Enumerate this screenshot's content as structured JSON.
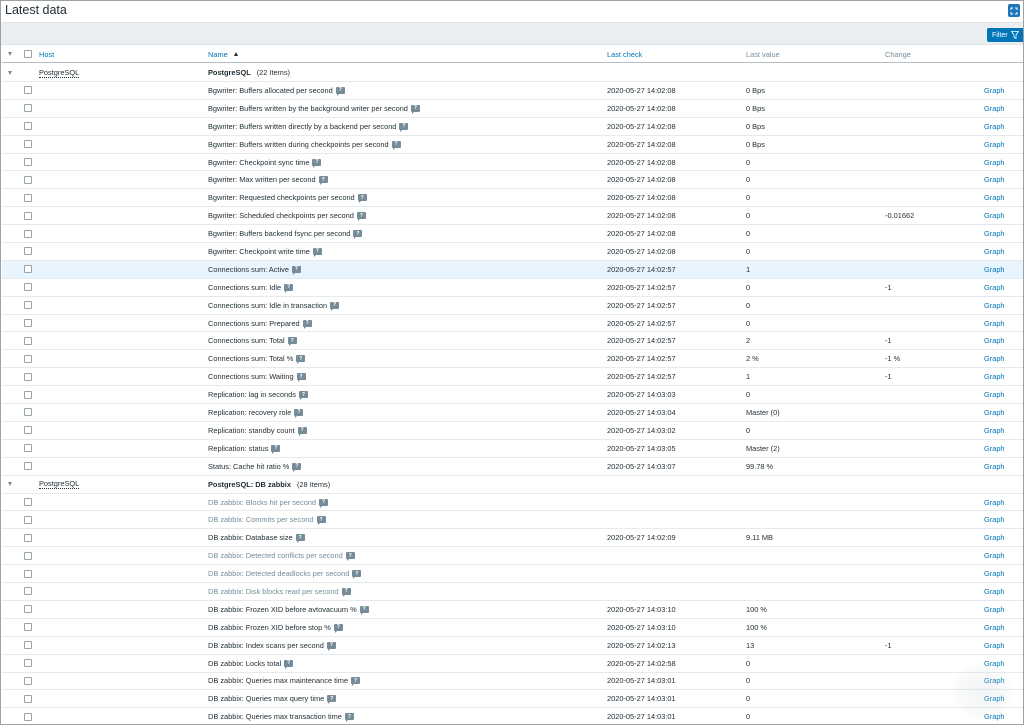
{
  "page": {
    "title": "Latest data"
  },
  "filter": {
    "label": "Filter"
  },
  "columns": {
    "host": "Host",
    "name": "Name",
    "last_check": "Last check",
    "last_value": "Last value",
    "change": "Change"
  },
  "groups": [
    {
      "host": "PostgreSQL",
      "app": "PostgreSQL",
      "count": "(22 Items)",
      "items": [
        {
          "name": "Bgwriter: Buffers allocated per second",
          "last_check": "2020-05-27 14:02:08",
          "value": "0 Bps",
          "change": "",
          "graph": "Graph"
        },
        {
          "name": "Bgwriter: Buffers written by the background writer per second",
          "last_check": "2020-05-27 14:02:08",
          "value": "0 Bps",
          "change": "",
          "graph": "Graph"
        },
        {
          "name": "Bgwriter: Buffers written directly by a backend per second",
          "last_check": "2020-05-27 14:02:08",
          "value": "0 Bps",
          "change": "",
          "graph": "Graph"
        },
        {
          "name": "Bgwriter: Buffers written during checkpoints per second",
          "last_check": "2020-05-27 14:02:08",
          "value": "0 Bps",
          "change": "",
          "graph": "Graph"
        },
        {
          "name": "Bgwriter: Checkpoint sync time",
          "last_check": "2020-05-27 14:02:08",
          "value": "0",
          "change": "",
          "graph": "Graph"
        },
        {
          "name": "Bgwriter: Max written per second",
          "last_check": "2020-05-27 14:02:08",
          "value": "0",
          "change": "",
          "graph": "Graph"
        },
        {
          "name": "Bgwriter: Requested checkpoints per second",
          "last_check": "2020-05-27 14:02:08",
          "value": "0",
          "change": "",
          "graph": "Graph"
        },
        {
          "name": "Bgwriter: Scheduled checkpoints per second",
          "last_check": "2020-05-27 14:02:08",
          "value": "0",
          "change": "-0.01662",
          "graph": "Graph"
        },
        {
          "name": "Bgwriter: Buffers backend fsync per second",
          "last_check": "2020-05-27 14:02:08",
          "value": "0",
          "change": "",
          "graph": "Graph"
        },
        {
          "name": "Bgwriter: Checkpoint write time",
          "last_check": "2020-05-27 14:02:08",
          "value": "0",
          "change": "",
          "graph": "Graph"
        },
        {
          "name": "Connections sum: Active",
          "last_check": "2020-05-27 14:02:57",
          "value": "1",
          "change": "",
          "graph": "Graph",
          "highlight": true
        },
        {
          "name": "Connections sum: Idle",
          "last_check": "2020-05-27 14:02:57",
          "value": "0",
          "change": "-1",
          "graph": "Graph"
        },
        {
          "name": "Connections sum: Idle in transaction",
          "last_check": "2020-05-27 14:02:57",
          "value": "0",
          "change": "",
          "graph": "Graph"
        },
        {
          "name": "Connections sum: Prepared",
          "last_check": "2020-05-27 14:02:57",
          "value": "0",
          "change": "",
          "graph": "Graph"
        },
        {
          "name": "Connections sum: Total",
          "last_check": "2020-05-27 14:02:57",
          "value": "2",
          "change": "-1",
          "graph": "Graph"
        },
        {
          "name": "Connections sum: Total %",
          "last_check": "2020-05-27 14:02:57",
          "value": "2 %",
          "change": "-1 %",
          "graph": "Graph"
        },
        {
          "name": "Connections sum: Waiting",
          "last_check": "2020-05-27 14:02:57",
          "value": "1",
          "change": "-1",
          "graph": "Graph"
        },
        {
          "name": "Replication: lag in seconds",
          "last_check": "2020-05-27 14:03:03",
          "value": "0",
          "change": "",
          "graph": "Graph"
        },
        {
          "name": "Replication: recovery role",
          "last_check": "2020-05-27 14:03:04",
          "value": "Master (0)",
          "change": "",
          "graph": "Graph"
        },
        {
          "name": "Replication: standby count",
          "last_check": "2020-05-27 14:03:02",
          "value": "0",
          "change": "",
          "graph": "Graph"
        },
        {
          "name": "Replication: status",
          "last_check": "2020-05-27 14:03:05",
          "value": "Master (2)",
          "change": "",
          "graph": "Graph"
        },
        {
          "name": "Status: Cache hit ratio %",
          "last_check": "2020-05-27 14:03:07",
          "value": "99.78 %",
          "change": "",
          "graph": "Graph"
        }
      ]
    },
    {
      "host": "PostgreSQL",
      "app": "PostgreSQL: DB zabbix",
      "count": "(28 Items)",
      "items": [
        {
          "name": "DB zabbix: Blocks hit per second",
          "last_check": "",
          "value": "",
          "change": "",
          "graph": "Graph",
          "muted": true
        },
        {
          "name": "DB zabbix: Commits per second",
          "last_check": "",
          "value": "",
          "change": "",
          "graph": "Graph",
          "muted": true
        },
        {
          "name": "DB zabbix: Database size",
          "last_check": "2020-05-27 14:02:09",
          "value": "9.11 MB",
          "change": "",
          "graph": "Graph"
        },
        {
          "name": "DB zabbix: Detected conflicts per second",
          "last_check": "",
          "value": "",
          "change": "",
          "graph": "Graph",
          "muted": true
        },
        {
          "name": "DB zabbix: Detected deadlocks per second",
          "last_check": "",
          "value": "",
          "change": "",
          "graph": "Graph",
          "muted": true
        },
        {
          "name": "DB zabbix: Disk blocks read per second",
          "last_check": "",
          "value": "",
          "change": "",
          "graph": "Graph",
          "muted": true
        },
        {
          "name": "DB zabbix: Frozen XID before avtovacuum %",
          "last_check": "2020-05-27 14:03:10",
          "value": "100 %",
          "change": "",
          "graph": "Graph"
        },
        {
          "name": "DB zabbix: Frozen XID before stop %",
          "last_check": "2020-05-27 14:03:10",
          "value": "100 %",
          "change": "",
          "graph": "Graph"
        },
        {
          "name": "DB zabbix: Index scans per second",
          "last_check": "2020-05-27 14:02:13",
          "value": "13",
          "change": "-1",
          "graph": "Graph"
        },
        {
          "name": "DB zabbix: Locks total",
          "last_check": "2020-05-27 14:02:58",
          "value": "0",
          "change": "",
          "graph": "Graph"
        },
        {
          "name": "DB zabbix: Queries max maintenance time",
          "last_check": "2020-05-27 14:03:01",
          "value": "0",
          "change": "",
          "graph": "Graph"
        },
        {
          "name": "DB zabbix: Queries max query time",
          "last_check": "2020-05-27 14:03:01",
          "value": "0",
          "change": "",
          "graph": "Graph"
        },
        {
          "name": "DB zabbix: Queries max transaction time",
          "last_check": "2020-05-27 14:03:01",
          "value": "0",
          "change": "",
          "graph": "Graph"
        }
      ]
    }
  ],
  "colors": {
    "link": "#0275b8",
    "highlight": "#e8f5ff",
    "muted": "#768d99",
    "filter_bg": "#0275b8"
  }
}
